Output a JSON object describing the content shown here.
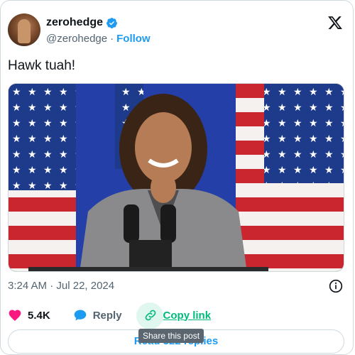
{
  "author": {
    "name": "zerohedge",
    "handle": "@zerohedge",
    "separator": "·",
    "follow_label": "Follow"
  },
  "tweet": {
    "text": "Hawk tuah!",
    "time": "3:24 AM",
    "date_separator": "·",
    "date": "Jul 22, 2024"
  },
  "actions": {
    "likes": "5.4K",
    "reply_label": "Reply",
    "copy_label": "Copy link"
  },
  "replies_button": "Read 322 replies",
  "tooltip": "Share this post",
  "colors": {
    "accent": "#1d9bf0",
    "like": "#f91880",
    "copy": "#00ba7c",
    "muted": "#536471"
  },
  "icons": [
    "verified-badge-icon",
    "x-logo-icon",
    "info-icon",
    "heart-icon",
    "reply-bubble-icon",
    "link-icon"
  ]
}
